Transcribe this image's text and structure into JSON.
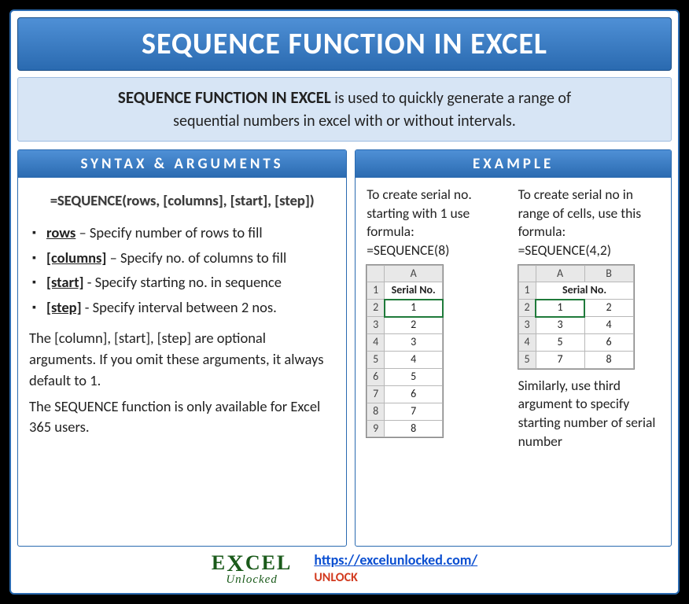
{
  "title": "SEQUENCE FUNCTION IN EXCEL",
  "intro": {
    "lead": "SEQUENCE FUNCTION IN EXCEL",
    "rest1": " is used to quickly generate a range of",
    "line2": "sequential numbers in excel with or without intervals."
  },
  "left": {
    "heading": "SYNTAX & ARGUMENTS",
    "syntax": "=SEQUENCE(rows, [columns], [start], [step])",
    "args": [
      {
        "name": "rows",
        "desc": " – Specify number of rows to fill"
      },
      {
        "name": "[columns]",
        "desc": " – Specify no. of columns to fill"
      },
      {
        "name": "[start]",
        "desc": " - Specify starting no. in sequence"
      },
      {
        "name": "[step]",
        "desc": " - Specify interval between 2  nos."
      }
    ],
    "p1": "The [column], [start], [step] are optional arguments. If you omit these arguments, it always default to 1.",
    "p2": "The SEQUENCE function is only available for Excel 365 users."
  },
  "right": {
    "heading": "EXAMPLE",
    "ex1": {
      "text": "To create serial no. starting with 1 use formula:",
      "formula": "=SEQUENCE(8)",
      "colA": "A",
      "label": "Serial No.",
      "rows": [
        {
          "r": "1"
        },
        {
          "r": "2",
          "v": "1"
        },
        {
          "r": "3",
          "v": "2"
        },
        {
          "r": "4",
          "v": "3"
        },
        {
          "r": "5",
          "v": "4"
        },
        {
          "r": "6",
          "v": "5"
        },
        {
          "r": "7",
          "v": "6"
        },
        {
          "r": "8",
          "v": "7"
        },
        {
          "r": "9",
          "v": "8"
        }
      ]
    },
    "ex2": {
      "text": "To create serial no in range of cells, use this formula:",
      "formula": "=SEQUENCE(4,2)",
      "colA": "A",
      "colB": "B",
      "label": "Serial No.",
      "rows": [
        {
          "r": "1"
        },
        {
          "r": "2",
          "a": "1",
          "b": "2"
        },
        {
          "r": "3",
          "a": "3",
          "b": "4"
        },
        {
          "r": "4",
          "a": "5",
          "b": "6"
        },
        {
          "r": "5",
          "a": "7",
          "b": "8"
        }
      ],
      "note": "Similarly, use third argument to specify starting number of serial number"
    }
  },
  "footer": {
    "logo_top": "E  CEL",
    "logo_x": "X",
    "logo_sub": "Unlocked",
    "url": "https://excelunlocked.com/",
    "unlock": "UNLOCK"
  }
}
